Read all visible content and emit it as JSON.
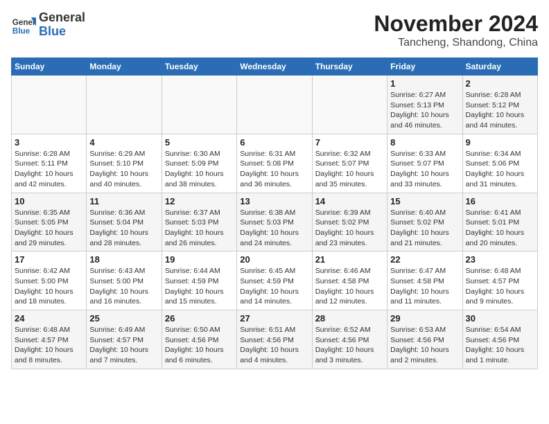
{
  "header": {
    "logo_general": "General",
    "logo_blue": "Blue",
    "month": "November 2024",
    "location": "Tancheng, Shandong, China"
  },
  "weekdays": [
    "Sunday",
    "Monday",
    "Tuesday",
    "Wednesday",
    "Thursday",
    "Friday",
    "Saturday"
  ],
  "weeks": [
    [
      {
        "day": "",
        "info": ""
      },
      {
        "day": "",
        "info": ""
      },
      {
        "day": "",
        "info": ""
      },
      {
        "day": "",
        "info": ""
      },
      {
        "day": "",
        "info": ""
      },
      {
        "day": "1",
        "info": "Sunrise: 6:27 AM\nSunset: 5:13 PM\nDaylight: 10 hours and 46 minutes."
      },
      {
        "day": "2",
        "info": "Sunrise: 6:28 AM\nSunset: 5:12 PM\nDaylight: 10 hours and 44 minutes."
      }
    ],
    [
      {
        "day": "3",
        "info": "Sunrise: 6:28 AM\nSunset: 5:11 PM\nDaylight: 10 hours and 42 minutes."
      },
      {
        "day": "4",
        "info": "Sunrise: 6:29 AM\nSunset: 5:10 PM\nDaylight: 10 hours and 40 minutes."
      },
      {
        "day": "5",
        "info": "Sunrise: 6:30 AM\nSunset: 5:09 PM\nDaylight: 10 hours and 38 minutes."
      },
      {
        "day": "6",
        "info": "Sunrise: 6:31 AM\nSunset: 5:08 PM\nDaylight: 10 hours and 36 minutes."
      },
      {
        "day": "7",
        "info": "Sunrise: 6:32 AM\nSunset: 5:07 PM\nDaylight: 10 hours and 35 minutes."
      },
      {
        "day": "8",
        "info": "Sunrise: 6:33 AM\nSunset: 5:07 PM\nDaylight: 10 hours and 33 minutes."
      },
      {
        "day": "9",
        "info": "Sunrise: 6:34 AM\nSunset: 5:06 PM\nDaylight: 10 hours and 31 minutes."
      }
    ],
    [
      {
        "day": "10",
        "info": "Sunrise: 6:35 AM\nSunset: 5:05 PM\nDaylight: 10 hours and 29 minutes."
      },
      {
        "day": "11",
        "info": "Sunrise: 6:36 AM\nSunset: 5:04 PM\nDaylight: 10 hours and 28 minutes."
      },
      {
        "day": "12",
        "info": "Sunrise: 6:37 AM\nSunset: 5:03 PM\nDaylight: 10 hours and 26 minutes."
      },
      {
        "day": "13",
        "info": "Sunrise: 6:38 AM\nSunset: 5:03 PM\nDaylight: 10 hours and 24 minutes."
      },
      {
        "day": "14",
        "info": "Sunrise: 6:39 AM\nSunset: 5:02 PM\nDaylight: 10 hours and 23 minutes."
      },
      {
        "day": "15",
        "info": "Sunrise: 6:40 AM\nSunset: 5:02 PM\nDaylight: 10 hours and 21 minutes."
      },
      {
        "day": "16",
        "info": "Sunrise: 6:41 AM\nSunset: 5:01 PM\nDaylight: 10 hours and 20 minutes."
      }
    ],
    [
      {
        "day": "17",
        "info": "Sunrise: 6:42 AM\nSunset: 5:00 PM\nDaylight: 10 hours and 18 minutes."
      },
      {
        "day": "18",
        "info": "Sunrise: 6:43 AM\nSunset: 5:00 PM\nDaylight: 10 hours and 16 minutes."
      },
      {
        "day": "19",
        "info": "Sunrise: 6:44 AM\nSunset: 4:59 PM\nDaylight: 10 hours and 15 minutes."
      },
      {
        "day": "20",
        "info": "Sunrise: 6:45 AM\nSunset: 4:59 PM\nDaylight: 10 hours and 14 minutes."
      },
      {
        "day": "21",
        "info": "Sunrise: 6:46 AM\nSunset: 4:58 PM\nDaylight: 10 hours and 12 minutes."
      },
      {
        "day": "22",
        "info": "Sunrise: 6:47 AM\nSunset: 4:58 PM\nDaylight: 10 hours and 11 minutes."
      },
      {
        "day": "23",
        "info": "Sunrise: 6:48 AM\nSunset: 4:57 PM\nDaylight: 10 hours and 9 minutes."
      }
    ],
    [
      {
        "day": "24",
        "info": "Sunrise: 6:48 AM\nSunset: 4:57 PM\nDaylight: 10 hours and 8 minutes."
      },
      {
        "day": "25",
        "info": "Sunrise: 6:49 AM\nSunset: 4:57 PM\nDaylight: 10 hours and 7 minutes."
      },
      {
        "day": "26",
        "info": "Sunrise: 6:50 AM\nSunset: 4:56 PM\nDaylight: 10 hours and 6 minutes."
      },
      {
        "day": "27",
        "info": "Sunrise: 6:51 AM\nSunset: 4:56 PM\nDaylight: 10 hours and 4 minutes."
      },
      {
        "day": "28",
        "info": "Sunrise: 6:52 AM\nSunset: 4:56 PM\nDaylight: 10 hours and 3 minutes."
      },
      {
        "day": "29",
        "info": "Sunrise: 6:53 AM\nSunset: 4:56 PM\nDaylight: 10 hours and 2 minutes."
      },
      {
        "day": "30",
        "info": "Sunrise: 6:54 AM\nSunset: 4:56 PM\nDaylight: 10 hours and 1 minute."
      }
    ]
  ]
}
